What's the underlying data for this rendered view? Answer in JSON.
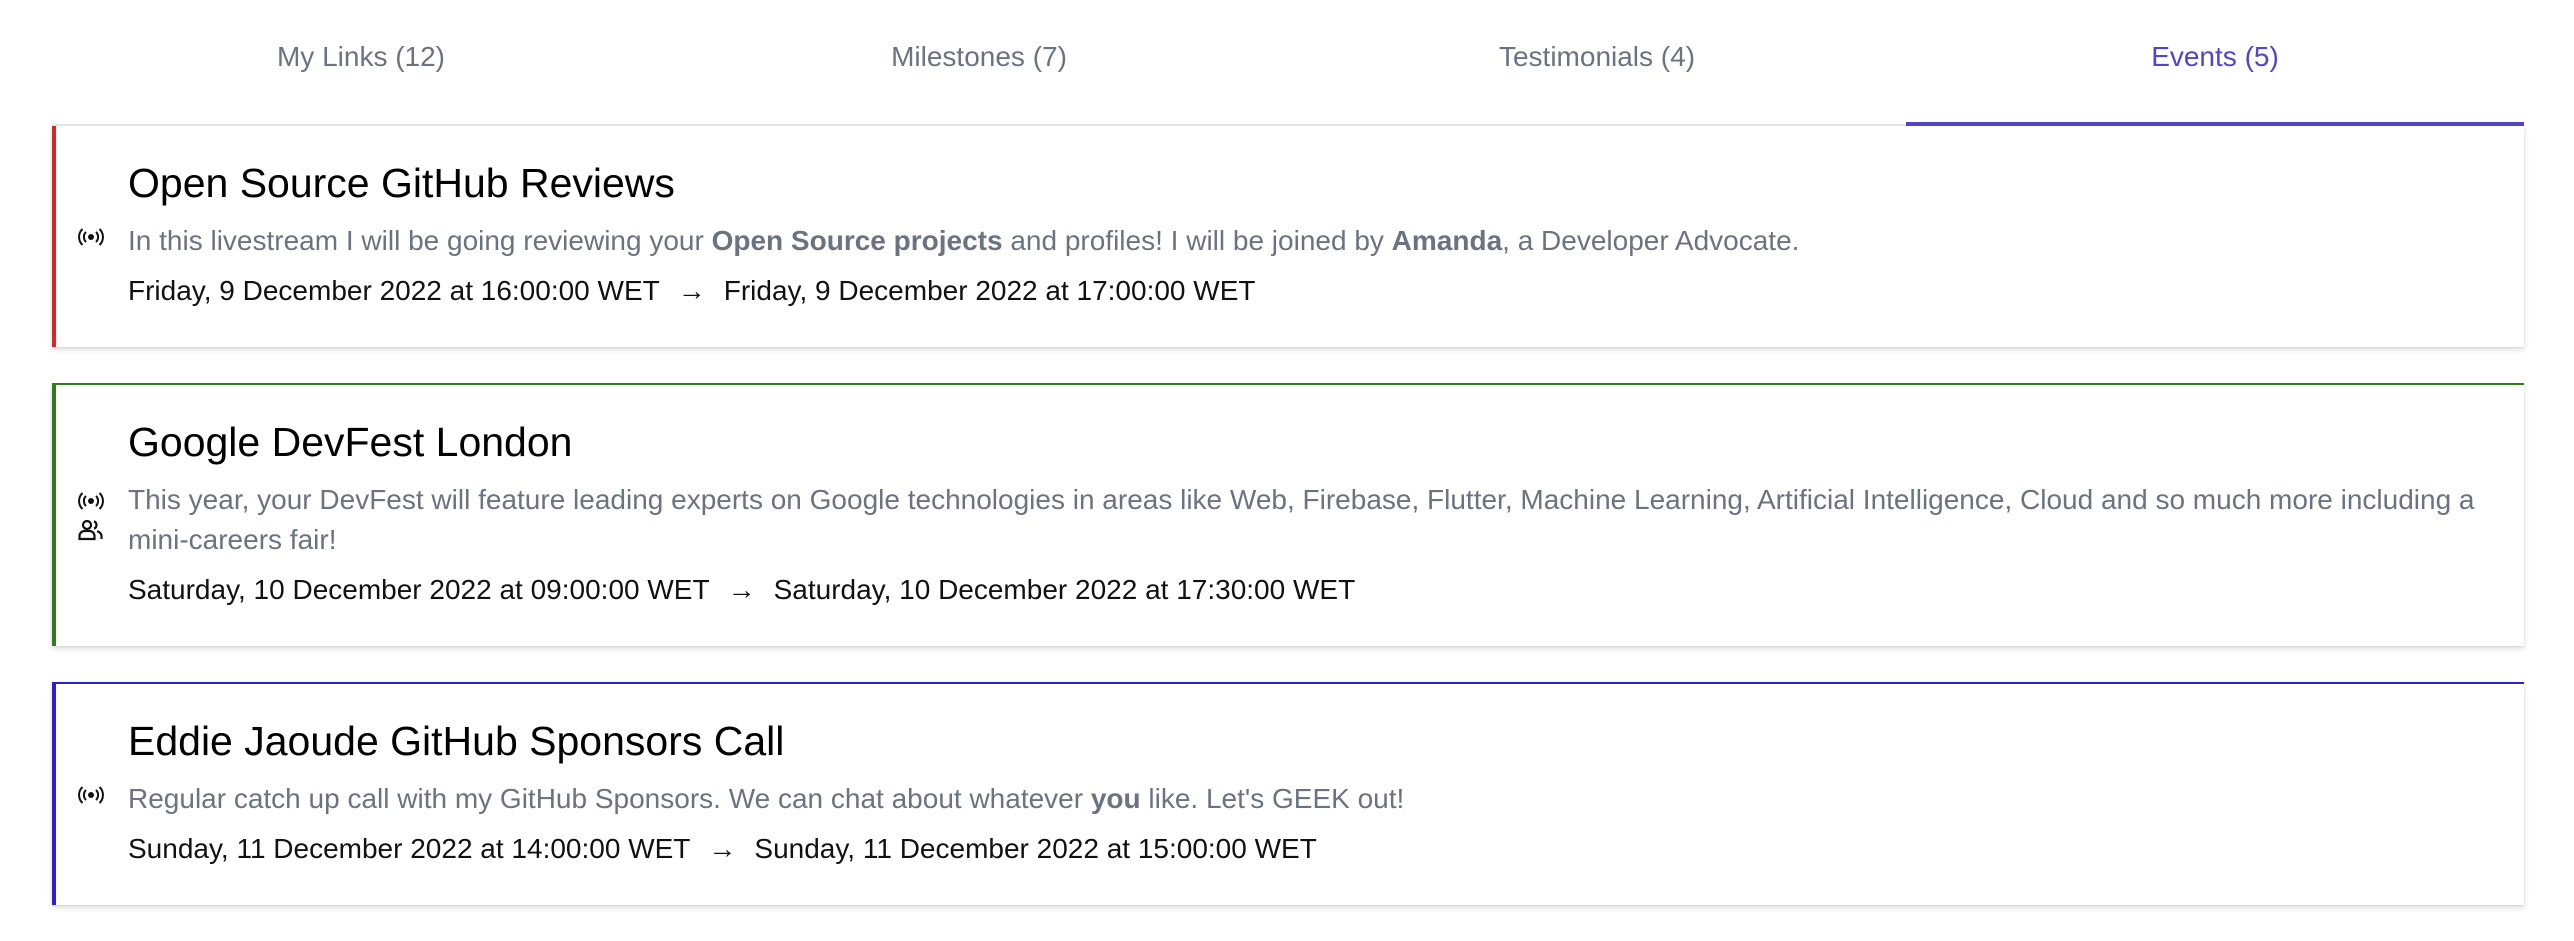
{
  "tabs": [
    {
      "label": "My Links (12)",
      "active": false
    },
    {
      "label": "Milestones (7)",
      "active": false
    },
    {
      "label": "Testimonials (4)",
      "active": false
    },
    {
      "label": "Events (5)",
      "active": true
    }
  ],
  "colors": {
    "accent": "#5046c8",
    "event1_border": "#dc2626",
    "event2_border": "#2f7d20",
    "event3_border": "#2b1fd1"
  },
  "events": [
    {
      "title": "Open Source GitHub Reviews",
      "desc_parts": [
        "In this livestream I will be going reviewing your ",
        "Open Source projects",
        " and profiles! I will be joined by ",
        "Amanda",
        ", a Developer Advocate."
      ],
      "start": "Friday, 9 December 2022 at 16:00:00 WET",
      "arrow": "→",
      "end": "Friday, 9 December 2022 at 17:00:00 WET",
      "icons": [
        "broadcast-icon"
      ]
    },
    {
      "title": "Google DevFest London",
      "desc_parts": [
        "This year, your DevFest will feature leading experts on Google technologies in areas like Web, Firebase, Flutter, Machine Learning, Artificial Intelligence, Cloud and so much more including a mini-careers fair!"
      ],
      "start": "Saturday, 10 December 2022 at 09:00:00 WET",
      "arrow": "→",
      "end": "Saturday, 10 December 2022 at 17:30:00 WET",
      "icons": [
        "broadcast-icon",
        "people-icon"
      ]
    },
    {
      "title": "Eddie Jaoude GitHub Sponsors Call",
      "desc_parts": [
        "Regular catch up call with my GitHub Sponsors. We can chat about whatever ",
        "you",
        " like. Let's GEEK out!"
      ],
      "start": "Sunday, 11 December 2022 at 14:00:00 WET",
      "arrow": "→",
      "end": "Sunday, 11 December 2022 at 15:00:00 WET",
      "icons": [
        "broadcast-icon"
      ]
    }
  ]
}
